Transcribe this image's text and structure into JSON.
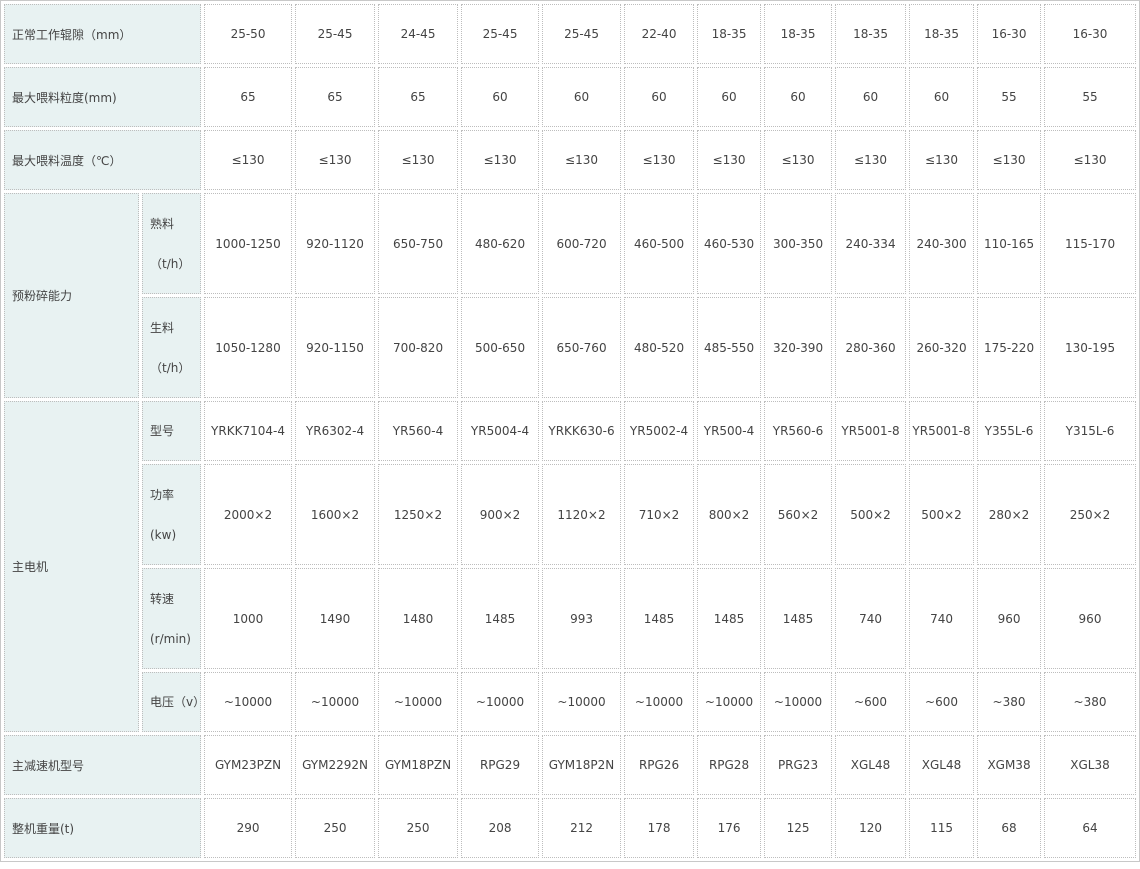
{
  "rows": [
    {
      "label": "正常工作辊隙（mm）",
      "values": [
        "25-50",
        "25-45",
        "24-45",
        "25-45",
        "25-45",
        "22-40",
        "18-35",
        "18-35",
        "18-35",
        "18-35",
        "16-30",
        "16-30"
      ]
    },
    {
      "label": "最大喂料粒度(mm)",
      "values": [
        "65",
        "65",
        "65",
        "60",
        "60",
        "60",
        "60",
        "60",
        "60",
        "60",
        "55",
        "55"
      ]
    },
    {
      "label": "最大喂料温度（℃）",
      "values": [
        "≤130",
        "≤130",
        "≤130",
        "≤130",
        "≤130",
        "≤130",
        "≤130",
        "≤130",
        "≤130",
        "≤130",
        "≤130",
        "≤130"
      ]
    }
  ],
  "prepulverizing": {
    "label": "预粉碎能力",
    "clinker": {
      "name": "熟料",
      "unit": "（t/h）",
      "values": [
        "1000-1250",
        "920-1120",
        "650-750",
        "480-620",
        "600-720",
        "460-500",
        "460-530",
        "300-350",
        "240-334",
        "240-300",
        "110-165",
        "115-170"
      ]
    },
    "raw": {
      "name": "生料",
      "unit": "（t/h）",
      "values": [
        "1050-1280",
        "920-1150",
        "700-820",
        "500-650",
        "650-760",
        "480-520",
        "485-550",
        "320-390",
        "280-360",
        "260-320",
        "175-220",
        "130-195"
      ]
    }
  },
  "motor": {
    "label": "主电机",
    "model": {
      "name": "型号",
      "values": [
        "YRKK7104-4",
        "YR6302-4",
        "YR560-4",
        "YR5004-4",
        "YRKK630-6",
        "YR5002-4",
        "YR500-4",
        "YR560-6",
        "YR5001-8",
        "YR5001-8",
        "Y355L-6",
        "Y315L-6"
      ]
    },
    "power": {
      "name": "功率",
      "unit": "(kw)",
      "values": [
        "2000×2",
        "1600×2",
        "1250×2",
        "900×2",
        "1120×2",
        "710×2",
        "800×2",
        "560×2",
        "500×2",
        "500×2",
        "280×2",
        "250×2"
      ]
    },
    "speed": {
      "name": "转速",
      "unit": "(r/min)",
      "values": [
        "1000",
        "1490",
        "1480",
        "1485",
        "993",
        "1485",
        "1485",
        "1485",
        "740",
        "740",
        "960",
        "960"
      ]
    },
    "voltage": {
      "name": "电压（v）",
      "values": [
        "~10000",
        "~10000",
        "~10000",
        "~10000",
        "~10000",
        "~10000",
        "~10000",
        "~10000",
        "~600",
        "~600",
        "~380",
        "~380"
      ]
    }
  },
  "reducer": {
    "label": "主减速机型号",
    "values": [
      "GYM23PZN",
      "GYM2292N",
      "GYM18PZN",
      "RPG29",
      "GYM18P2N",
      "RPG26",
      "RPG28",
      "PRG23",
      "XGL48",
      "XGL48",
      "XGM38",
      "XGL38"
    ]
  },
  "weight": {
    "label": "整机重量(t)",
    "values": [
      "290",
      "250",
      "250",
      "208",
      "212",
      "178",
      "176",
      "125",
      "120",
      "115",
      "68",
      "64"
    ]
  }
}
